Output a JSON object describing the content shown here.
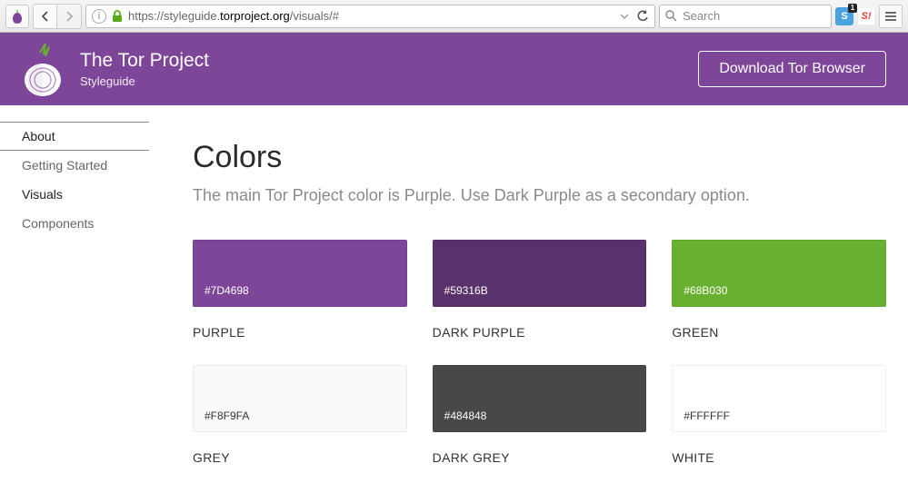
{
  "browser": {
    "url_prefix": "https://styleguide.",
    "url_domain": "torproject.org",
    "url_path": "/visuals/#",
    "search_placeholder": "Search",
    "ext_badge": "1"
  },
  "header": {
    "title": "The Tor Project",
    "subtitle": "Styleguide",
    "download_label": "Download Tor Browser"
  },
  "sidebar": {
    "items": [
      {
        "label": "About"
      },
      {
        "label": "Getting Started"
      },
      {
        "label": "Visuals"
      },
      {
        "label": "Components"
      }
    ]
  },
  "main": {
    "title": "Colors",
    "description": "The main Tor Project color is Purple. Use Dark Purple as a secondary option."
  },
  "colors": [
    {
      "hex": "#7D4698",
      "name": "PURPLE",
      "bg": "#7D4698",
      "text_dark": false
    },
    {
      "hex": "#59316B",
      "name": "DARK PURPLE",
      "bg": "#59316B",
      "text_dark": false
    },
    {
      "hex": "#68B030",
      "name": "GREEN",
      "bg": "#68B030",
      "text_dark": false
    },
    {
      "hex": "#F8F9FA",
      "name": "GREY",
      "bg": "#F8F9FA",
      "text_dark": true
    },
    {
      "hex": "#484848",
      "name": "DARK GREY",
      "bg": "#484848",
      "text_dark": false
    },
    {
      "hex": "#FFFFFF",
      "name": "WHITE",
      "bg": "#FFFFFF",
      "text_dark": true
    }
  ]
}
